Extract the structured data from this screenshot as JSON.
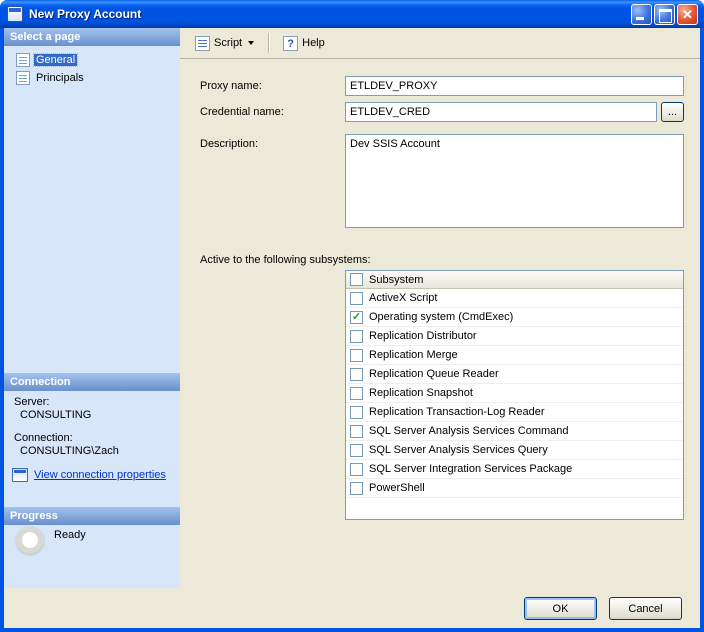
{
  "window": {
    "title": "New Proxy Account"
  },
  "icons": {
    "close": "✕",
    "check": "✓"
  },
  "colors": {
    "titlebar_blue": "#0054E3",
    "selection_blue": "#316AC5",
    "check_green": "#21A121",
    "link_blue": "#0033CC",
    "panel_tan": "#ECE9D8",
    "sidebar_blue": "#D7E6F9"
  },
  "sidebar": {
    "select_page_header": "Select a page",
    "pages": [
      {
        "label": "General",
        "selected": true
      },
      {
        "label": "Principals",
        "selected": false
      }
    ],
    "connection": {
      "header": "Connection",
      "server_label": "Server:",
      "server_value": "CONSULTING",
      "connection_label": "Connection:",
      "connection_value": "CONSULTING\\Zach",
      "link": "View connection properties"
    },
    "progress": {
      "header": "Progress",
      "status": "Ready"
    }
  },
  "toolbar": {
    "script": "Script",
    "help": "Help"
  },
  "form": {
    "proxy_name_label": "Proxy name:",
    "proxy_name_value": "ETLDEV_PROXY",
    "credential_name_label": "Credential name:",
    "credential_name_value": "ETLDEV_CRED",
    "browse_label": "...",
    "description_label": "Description:",
    "description_value": "Dev SSIS Account",
    "subsystems_label": "Active to the following subsystems:"
  },
  "subsystems": {
    "header": "Subsystem",
    "rows": [
      {
        "name": "ActiveX Script",
        "checked": false
      },
      {
        "name": "Operating system (CmdExec)",
        "checked": true
      },
      {
        "name": "Replication Distributor",
        "checked": false
      },
      {
        "name": "Replication Merge",
        "checked": false
      },
      {
        "name": "Replication Queue Reader",
        "checked": false
      },
      {
        "name": "Replication Snapshot",
        "checked": false
      },
      {
        "name": "Replication Transaction-Log Reader",
        "checked": false
      },
      {
        "name": "SQL Server Analysis Services Command",
        "checked": false
      },
      {
        "name": "SQL Server Analysis Services Query",
        "checked": false
      },
      {
        "name": "SQL Server Integration Services Package",
        "checked": false
      },
      {
        "name": "PowerShell",
        "checked": false
      }
    ]
  },
  "footer": {
    "ok": "OK",
    "cancel": "Cancel"
  }
}
